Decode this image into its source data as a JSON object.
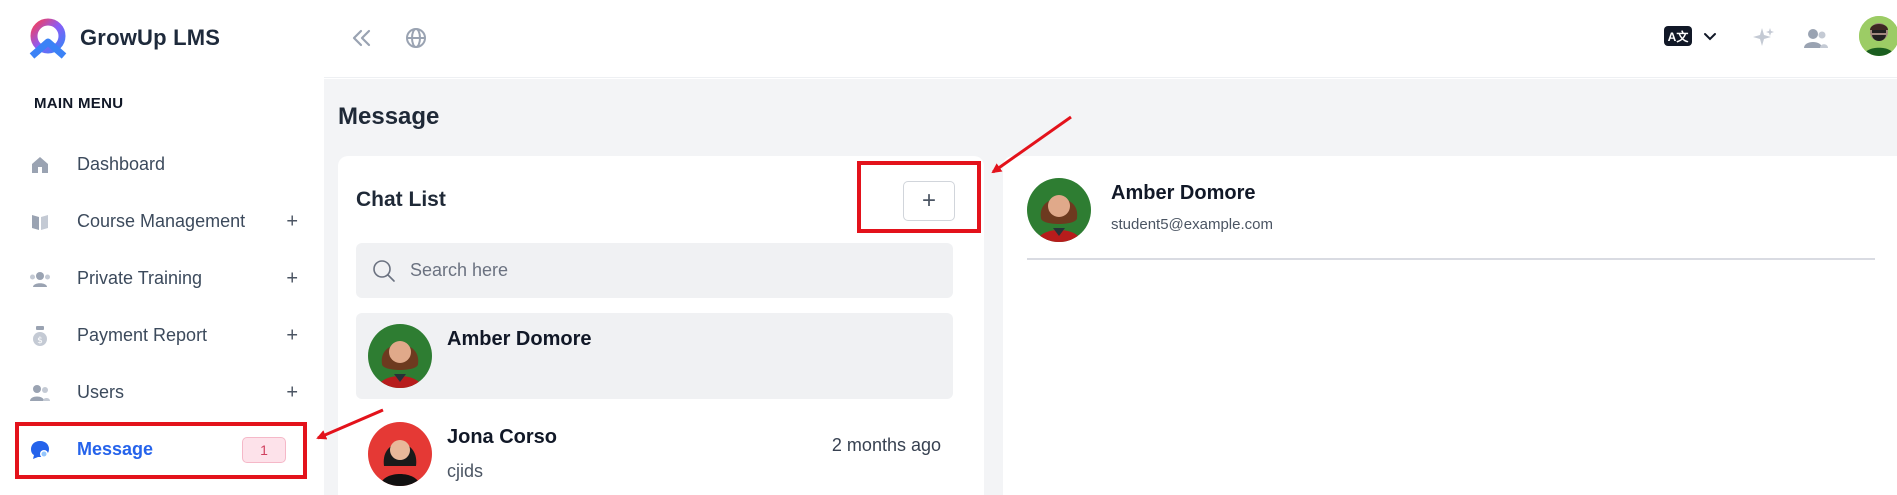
{
  "brand": {
    "name": "GrowUp LMS",
    "logo_icon": "growup-logo-icon"
  },
  "sidebar": {
    "menu_title": "MAIN MENU",
    "items": [
      {
        "label": "Dashboard",
        "icon": "home-icon",
        "expandable": false
      },
      {
        "label": "Course Management",
        "icon": "book-icon",
        "expandable": true,
        "toggle": "+"
      },
      {
        "label": "Private Training",
        "icon": "group-icon",
        "expandable": true,
        "toggle": "+"
      },
      {
        "label": "Payment Report",
        "icon": "money-bag-icon",
        "expandable": true,
        "toggle": "+"
      },
      {
        "label": "Users",
        "icon": "users-icon",
        "expandable": true,
        "toggle": "+"
      },
      {
        "label": "Message",
        "icon": "chat-icon",
        "active": true,
        "badge": "1"
      }
    ]
  },
  "topbar": {
    "collapse_icon": "double-chevron-left-icon",
    "globe_icon": "globe-icon",
    "language_icon": "translate-icon",
    "language_label": "A文",
    "sparkle_icon": "sparkle-icon",
    "users_icon": "users-icon"
  },
  "main": {
    "page_title": "Message",
    "chat_list": {
      "title": "Chat List",
      "add_label": "+",
      "search_placeholder": "Search here",
      "contacts": [
        {
          "name": "Amber Domore",
          "subtitle": "",
          "time": "",
          "selected": true
        },
        {
          "name": "Jona Corso",
          "subtitle": "cjids",
          "time": "2 months ago",
          "selected": false
        }
      ]
    },
    "chat_panel": {
      "name": "Amber Domore",
      "email": "student5@example.com"
    }
  },
  "colors": {
    "accent": "#2563eb",
    "annotation": "#e3121b",
    "badge_bg": "#fde2ea",
    "badge_text": "#d0405f"
  }
}
